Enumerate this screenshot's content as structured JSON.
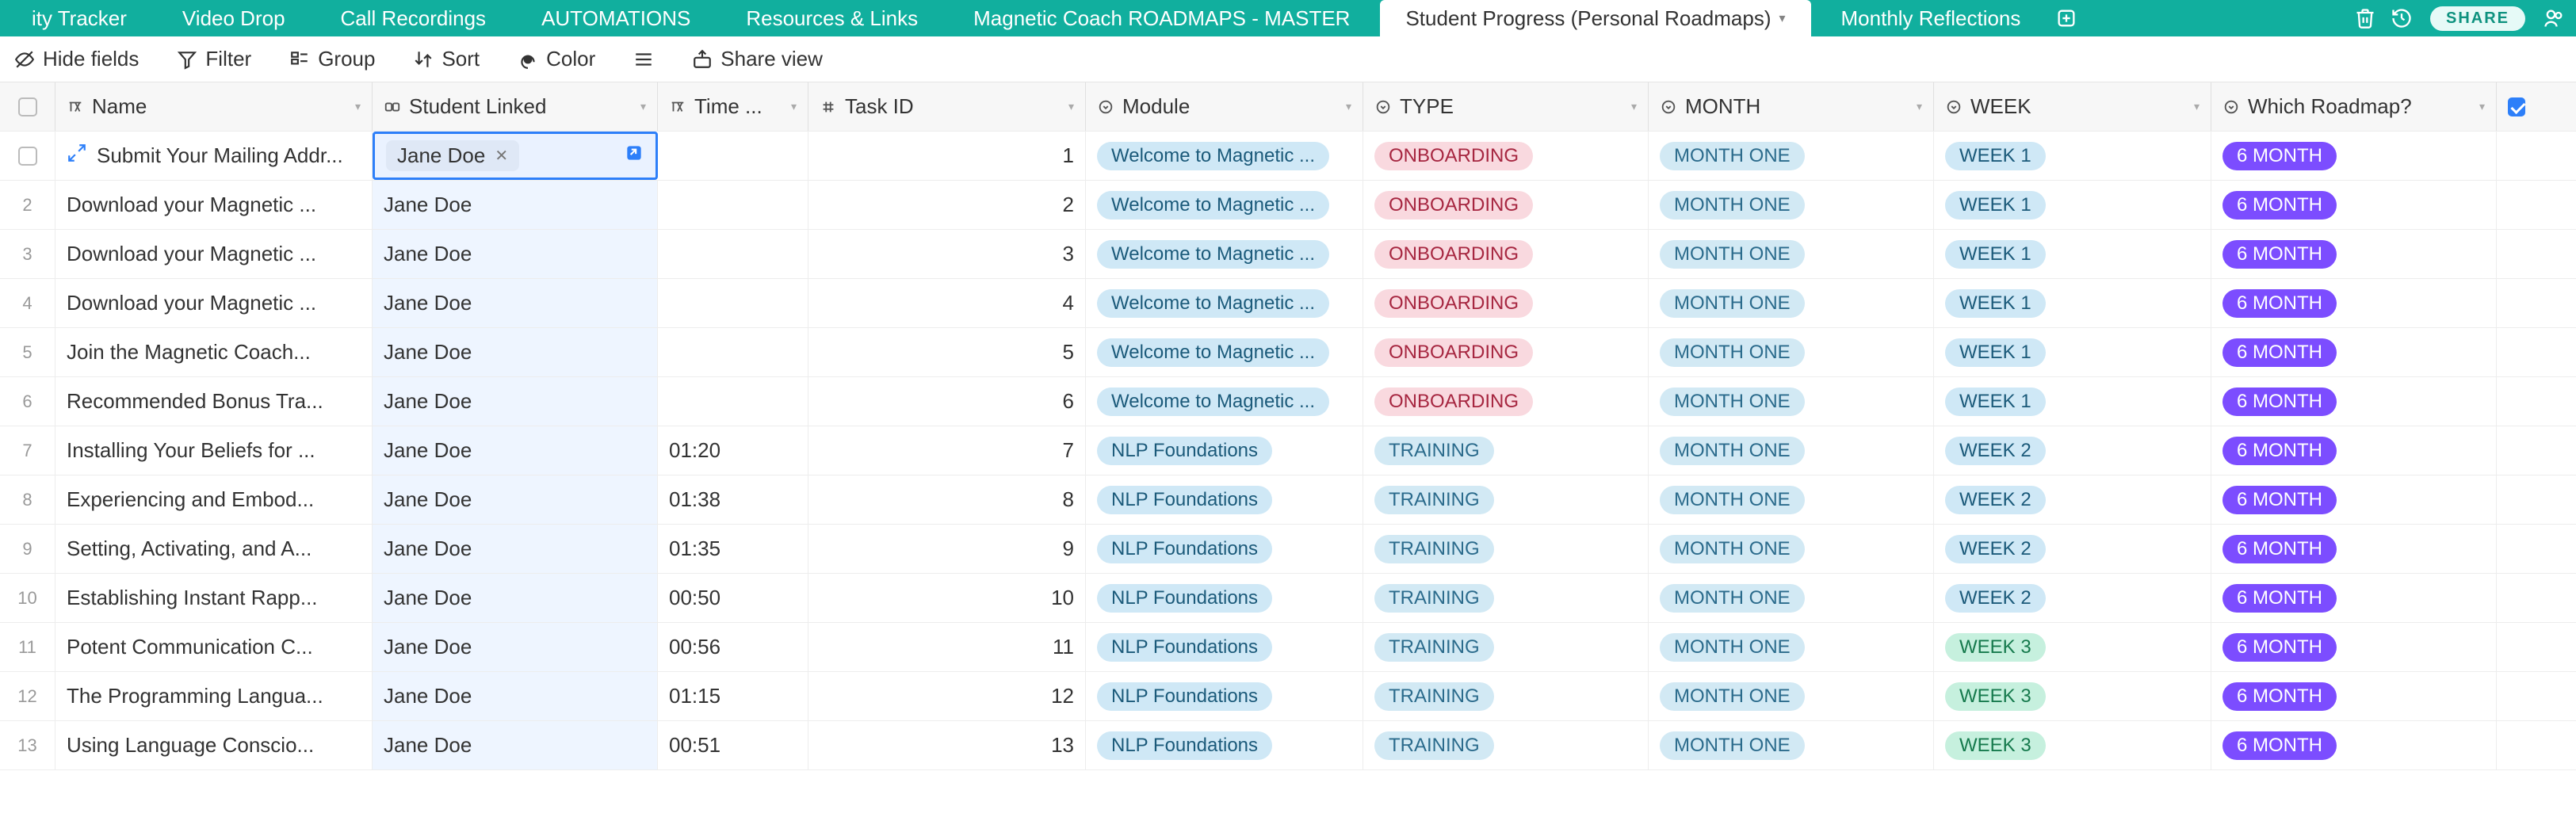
{
  "tabs": [
    {
      "label": "ity Tracker"
    },
    {
      "label": "Video Drop"
    },
    {
      "label": "Call Recordings"
    },
    {
      "label": "AUTOMATIONS"
    },
    {
      "label": "Resources & Links"
    },
    {
      "label": "Magnetic Coach ROADMAPS - MASTER"
    },
    {
      "label": "Student Progress (Personal Roadmaps)",
      "active": true
    },
    {
      "label": "Monthly Reflections"
    }
  ],
  "share_label": "SHARE",
  "toolbar": {
    "hide_fields": "Hide fields",
    "filter": "Filter",
    "group": "Group",
    "sort": "Sort",
    "color": "Color",
    "share_view": "Share view"
  },
  "columns": {
    "name": "Name",
    "student": "Student Linked",
    "time": "Time ...",
    "task": "Task ID",
    "module": "Module",
    "type": "TYPE",
    "month": "MONTH",
    "week": "WEEK",
    "roadmap": "Which Roadmap?"
  },
  "rows": [
    {
      "n": 1,
      "name": "Submit Your Mailing Addr...",
      "student": "Jane Doe",
      "time": "",
      "task": "1",
      "module": "Welcome to Magnetic ...",
      "type": "ONBOARDING",
      "month": "MONTH ONE",
      "week": "WEEK 1",
      "road": "6 MONTH",
      "selected": true
    },
    {
      "n": 2,
      "name": "Download your Magnetic ...",
      "student": "Jane Doe",
      "time": "",
      "task": "2",
      "module": "Welcome to Magnetic ...",
      "type": "ONBOARDING",
      "month": "MONTH ONE",
      "week": "WEEK 1",
      "road": "6 MONTH"
    },
    {
      "n": 3,
      "name": "Download your Magnetic ...",
      "student": "Jane Doe",
      "time": "",
      "task": "3",
      "module": "Welcome to Magnetic ...",
      "type": "ONBOARDING",
      "month": "MONTH ONE",
      "week": "WEEK 1",
      "road": "6 MONTH"
    },
    {
      "n": 4,
      "name": "Download your Magnetic ...",
      "student": "Jane Doe",
      "time": "",
      "task": "4",
      "module": "Welcome to Magnetic ...",
      "type": "ONBOARDING",
      "month": "MONTH ONE",
      "week": "WEEK 1",
      "road": "6 MONTH"
    },
    {
      "n": 5,
      "name": "Join the Magnetic Coach...",
      "student": "Jane Doe",
      "time": "",
      "task": "5",
      "module": "Welcome to Magnetic ...",
      "type": "ONBOARDING",
      "month": "MONTH ONE",
      "week": "WEEK 1",
      "road": "6 MONTH"
    },
    {
      "n": 6,
      "name": "Recommended Bonus Tra...",
      "student": "Jane Doe",
      "time": "",
      "task": "6",
      "module": "Welcome to Magnetic ...",
      "type": "ONBOARDING",
      "month": "MONTH ONE",
      "week": "WEEK 1",
      "road": "6 MONTH"
    },
    {
      "n": 7,
      "name": "Installing Your Beliefs for ...",
      "student": "Jane Doe",
      "time": "01:20",
      "task": "7",
      "module": "NLP Foundations",
      "type": "TRAINING",
      "month": "MONTH ONE",
      "week": "WEEK 2",
      "road": "6 MONTH"
    },
    {
      "n": 8,
      "name": "Experiencing and Embod...",
      "student": "Jane Doe",
      "time": "01:38",
      "task": "8",
      "module": "NLP Foundations",
      "type": "TRAINING",
      "month": "MONTH ONE",
      "week": "WEEK 2",
      "road": "6 MONTH"
    },
    {
      "n": 9,
      "name": "Setting, Activating, and A...",
      "student": "Jane Doe",
      "time": "01:35",
      "task": "9",
      "module": "NLP Foundations",
      "type": "TRAINING",
      "month": "MONTH ONE",
      "week": "WEEK 2",
      "road": "6 MONTH"
    },
    {
      "n": 10,
      "name": "Establishing Instant Rapp...",
      "student": "Jane Doe",
      "time": "00:50",
      "task": "10",
      "module": "NLP Foundations",
      "type": "TRAINING",
      "month": "MONTH ONE",
      "week": "WEEK 2",
      "road": "6 MONTH"
    },
    {
      "n": 11,
      "name": "Potent Communication C...",
      "student": "Jane Doe",
      "time": "00:56",
      "task": "11",
      "module": "NLP Foundations",
      "type": "TRAINING",
      "month": "MONTH ONE",
      "week": "WEEK 3",
      "road": "6 MONTH"
    },
    {
      "n": 12,
      "name": "The Programming Langua...",
      "student": "Jane Doe",
      "time": "01:15",
      "task": "12",
      "module": "NLP Foundations",
      "type": "TRAINING",
      "month": "MONTH ONE",
      "week": "WEEK 3",
      "road": "6 MONTH"
    },
    {
      "n": 13,
      "name": "Using Language Conscio...",
      "student": "Jane Doe",
      "time": "00:51",
      "task": "13",
      "module": "NLP Foundations",
      "type": "TRAINING",
      "month": "MONTH ONE",
      "week": "WEEK 3",
      "road": "6 MONTH"
    }
  ]
}
